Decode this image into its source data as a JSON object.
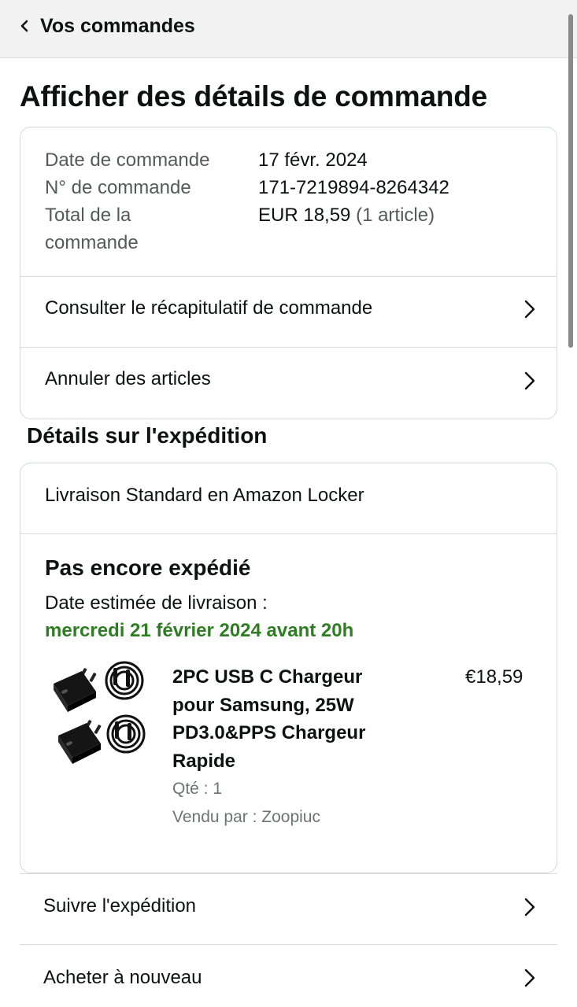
{
  "nav": {
    "back_label": "Vos commandes"
  },
  "page_title": "Afficher des détails de commande",
  "order_info": {
    "date_label": "Date de commande",
    "date_value": "17 févr. 2024",
    "number_label": "N° de commande",
    "number_value": "171-7219894-8264342",
    "total_label_line1": "Total de la",
    "total_label_line2": "commande",
    "total_value": "EUR 18,59",
    "total_items": "(1 article)"
  },
  "order_actions": {
    "summary_label": "Consulter le récapitulatif de commande",
    "cancel_label": "Annuler des articles"
  },
  "shipping": {
    "section_title": "Détails sur l'expédition",
    "method": "Livraison Standard en Amazon Locker",
    "status": "Pas encore expédié",
    "estimate_label": "Date estimée de livraison :",
    "estimate_date": "mercredi 21 février 2024 avant 20h",
    "accent_color": "#2f7d22"
  },
  "product": {
    "title": "2PC USB C Chargeur pour Samsung, 25W PD3.0&PPS Chargeur Rapide",
    "price": "€18,59",
    "quantity": "Qté : 1",
    "seller": "Vendu par : Zoopiuc"
  },
  "bottom_actions": {
    "track_label": "Suivre l'expédition",
    "rebuy_label": "Acheter à nouveau"
  },
  "icons": {
    "back": "chevron-left-icon",
    "row": "chevron-right-icon",
    "product": "usb-c-charger-image"
  }
}
